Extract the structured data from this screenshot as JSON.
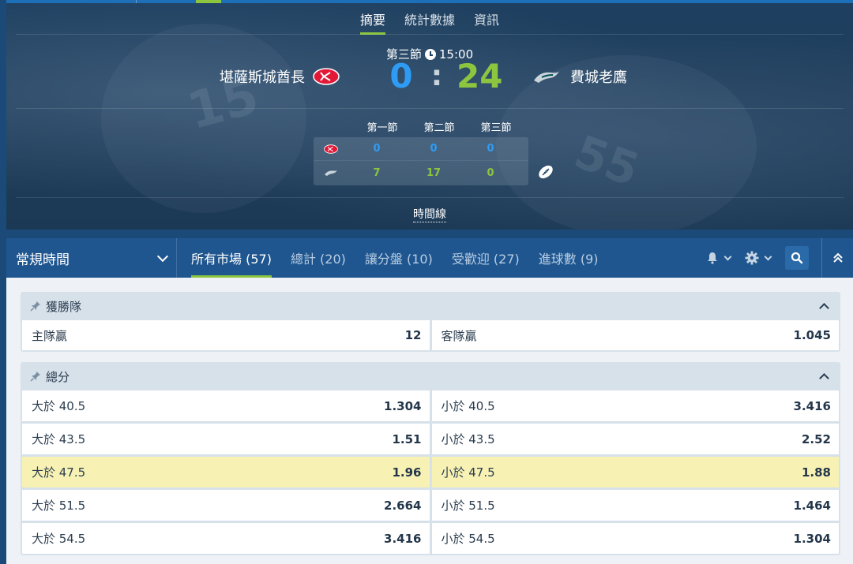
{
  "hero": {
    "tabs": [
      "摘要",
      "統計數據",
      "資訊"
    ],
    "active_tab": 0,
    "period": "第三節",
    "clock": "15:00",
    "home_team": "堪薩斯城酋長",
    "away_team": "費城老鷹",
    "home_score": "0",
    "away_score": "24",
    "score_sep": ":",
    "period_headers": [
      "第一節",
      "第二節",
      "第三節"
    ],
    "home_periods": [
      "0",
      "0",
      "0"
    ],
    "away_periods": [
      "7",
      "17",
      "0"
    ],
    "timeline_label": "時間線",
    "colors": {
      "home": "#2e9cf5",
      "away": "#8cc63f"
    }
  },
  "nav": {
    "period_select": "常規時間",
    "tabs": [
      "所有市場 (57)",
      "總計 (20)",
      "讓分盤 (10)",
      "受歡迎 (27)",
      "進球數 (9)"
    ],
    "active_tab": 0
  },
  "markets": [
    {
      "title": "獲勝隊",
      "rows": [
        [
          {
            "label": "主隊贏",
            "price": "12"
          },
          {
            "label": "客隊贏",
            "price": "1.045"
          }
        ]
      ]
    },
    {
      "title": "總分",
      "rows": [
        [
          {
            "label": "大於 40.5",
            "price": "1.304"
          },
          {
            "label": "小於 40.5",
            "price": "3.416"
          }
        ],
        [
          {
            "label": "大於 43.5",
            "price": "1.51"
          },
          {
            "label": "小於 43.5",
            "price": "2.52"
          }
        ],
        [
          {
            "label": "大於 47.5",
            "price": "1.96"
          },
          {
            "label": "小於 47.5",
            "price": "1.88"
          }
        ],
        [
          {
            "label": "大於 51.5",
            "price": "2.664"
          },
          {
            "label": "小於 51.5",
            "price": "1.464"
          }
        ],
        [
          {
            "label": "大於 54.5",
            "price": "3.416"
          },
          {
            "label": "小於 54.5",
            "price": "1.304"
          }
        ]
      ]
    }
  ]
}
